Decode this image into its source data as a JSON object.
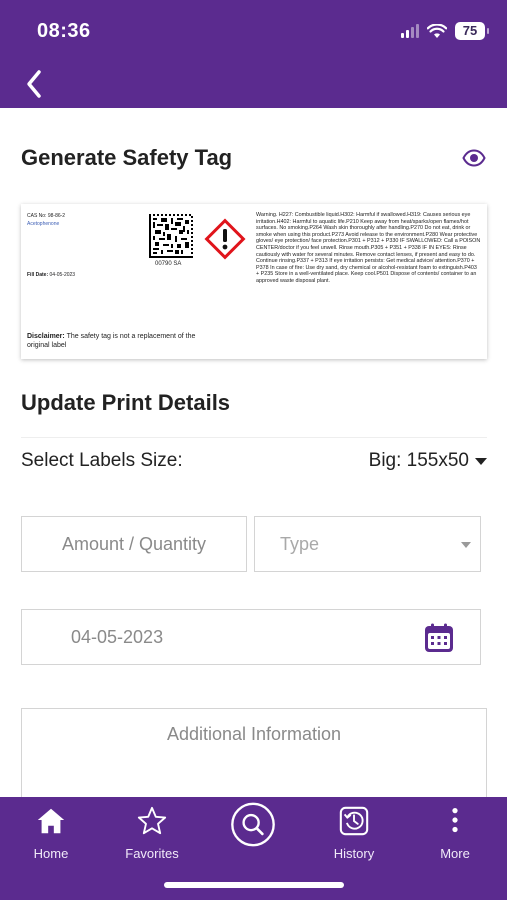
{
  "status_bar": {
    "time": "08:36",
    "battery": "75"
  },
  "header": {
    "back_icon": "chevron-left-icon",
    "bg_color": "#5b2b8f"
  },
  "page": {
    "title": "Generate Safety Tag",
    "preview_icon": "eye-icon"
  },
  "safety_tag": {
    "cas": "CAS No: 98-86-2",
    "chemical": "Acetophenone",
    "fill_date_label": "Fill Date:",
    "fill_date": "04-05-2023",
    "barcode_code": "00790 SA",
    "hazard_icon": "exclamation-mark-ghs-icon",
    "warning_text": "Warning. H227: Combustible liquid.H302: Harmful if swallowed.H319: Causes serious eye irritation.H402: Harmful to aquatic life.P210 Keep away from heat/sparks/open flames/hot surfaces. No smoking.P264 Wash skin thoroughly after handling.P270 Do not eat, drink or smoke when using this product.P273 Avoid release to the environment.P280 Wear protective gloves/ eye protection/ face protection.P301 + P312 + P330 IF SWALLOWED: Call a POISON CENTER/doctor if you feel unwell. Rinse mouth.P305 + P351 + P338 IF IN EYES: Rinse cautiously with water for several minutes. Remove contact lenses, if present and easy to do. Continue rinsing.P337 + P313 If eye irritation persists: Get medical advice/ attention.P370 + P378 In case of fire: Use dry sand, dry chemical or alcohol-resistant foam to extinguish.P403 + P235 Store in a well-ventilated place. Keep cool.P501 Dispose of contents/ container to an approved waste disposal plant.",
    "disclaimer_label": "Disclaimer:",
    "disclaimer_text": " The safety tag is not a replacement of the original label"
  },
  "print_details": {
    "title": "Update Print Details",
    "labels_size_label": "Select Labels Size:",
    "labels_size_value": "Big: 155x50",
    "amount_placeholder": "Amount / Quantity",
    "type_placeholder": "Type",
    "date_value": "04-05-2023",
    "calendar_icon": "calendar-icon",
    "additional_info_placeholder": "Additional Information"
  },
  "tabbar": {
    "items": [
      {
        "label": "Home",
        "icon": "home-icon"
      },
      {
        "label": "Favorites",
        "icon": "star-icon"
      },
      {
        "label": "",
        "icon": "search-icon"
      },
      {
        "label": "History",
        "icon": "history-icon"
      },
      {
        "label": "More",
        "icon": "more-vertical-icon"
      }
    ]
  }
}
